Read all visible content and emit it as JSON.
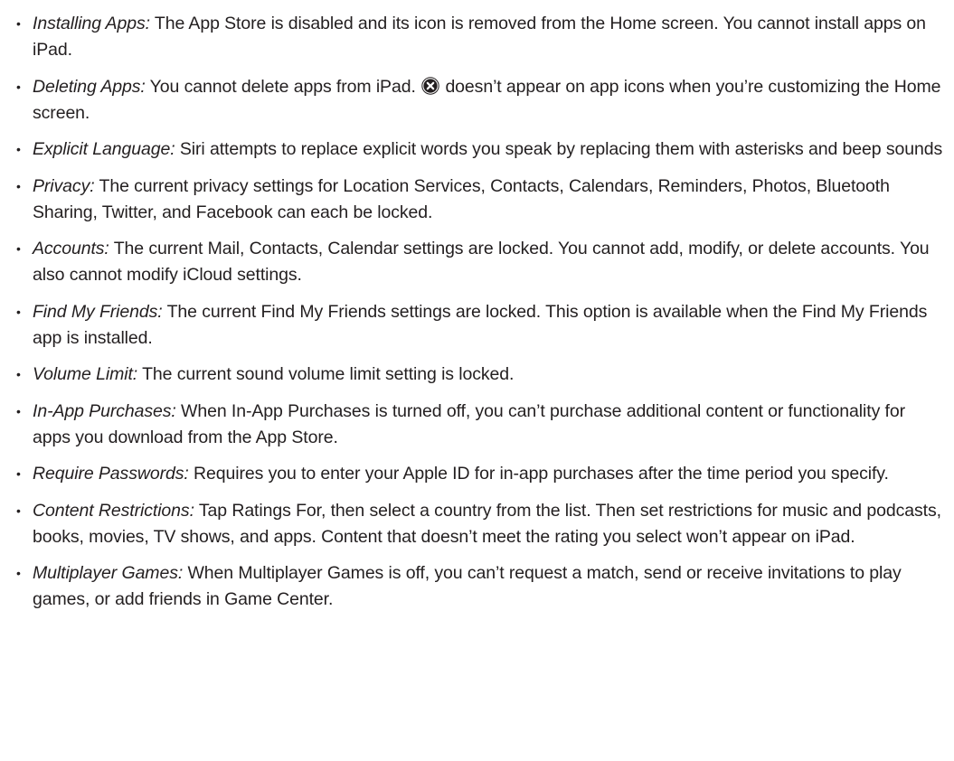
{
  "items": [
    {
      "term": "Installing Apps:",
      "text": "The App Store is disabled and its icon is removed from the Home screen. You cannot install apps on iPad."
    },
    {
      "term": "Deleting Apps:",
      "text_before_icon": "You cannot delete apps from iPad.",
      "icon": "delete-badge-icon",
      "text_after_icon": "doesn’t appear on app icons when you’re customizing the Home screen."
    },
    {
      "term": "Explicit Language:",
      "text": "Siri attempts to replace explicit words you speak by replacing them with asterisks and beep sounds"
    },
    {
      "term": "Privacy:",
      "text": "The current privacy settings for Location Services, Contacts, Calendars, Reminders, Photos, Bluetooth Sharing, Twitter, and Facebook can each be locked."
    },
    {
      "term": "Accounts:",
      "text": "The current Mail, Contacts, Calendar settings are locked. You cannot add, modify, or delete accounts. You also cannot modify iCloud settings."
    },
    {
      "term": "Find My Friends:",
      "text": "The current Find My Friends settings are locked. This option is available when the Find My Friends app is installed."
    },
    {
      "term": "Volume Limit:",
      "text": "The current sound volume limit setting is locked."
    },
    {
      "term": "In-App Purchases:",
      "text": "When In-App Purchases is turned off, you can’t purchase additional content or functionality for apps you download from the App Store."
    },
    {
      "term": "Require Passwords:",
      "text": "Requires you to enter your Apple ID for in-app purchases after the time period you specify."
    },
    {
      "term": "Content Restrictions:",
      "text": "Tap Ratings For, then select a country from the list. Then set restrictions for music and podcasts, books, movies, TV shows, and apps. Content that doesn’t meet the rating you select won’t appear on iPad."
    },
    {
      "term": "Multiplayer Games:",
      "text": "When Multiplayer Games is off, you can’t request a match, send or receive invitations to play games, or add friends in Game Center."
    }
  ]
}
